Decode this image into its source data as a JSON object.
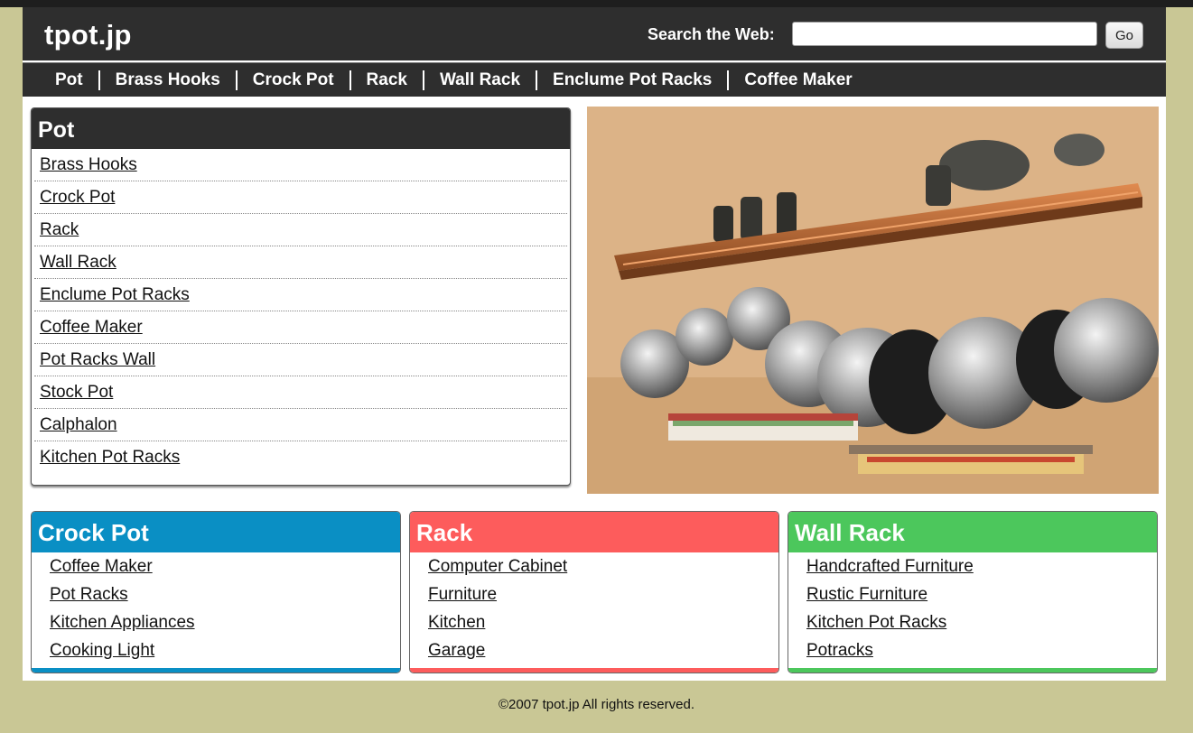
{
  "header": {
    "logo": "tpot.jp",
    "search_label": "Search the Web:",
    "search_placeholder": "",
    "go_label": "Go"
  },
  "nav": [
    "Pot",
    "Brass Hooks",
    "Crock Pot",
    "Rack",
    "Wall Rack",
    "Enclume Pot Racks",
    "Coffee Maker"
  ],
  "pot_panel": {
    "title": "Pot",
    "links": [
      "Brass Hooks",
      "Crock Pot",
      "Rack",
      "Wall Rack",
      "Enclume Pot Racks",
      "Coffee Maker",
      "Pot Racks Wall",
      "Stock Pot",
      "Calphalon",
      "Kitchen Pot Racks"
    ]
  },
  "boxes": [
    {
      "title": "Crock Pot",
      "color": "#0a8fc4",
      "links": [
        "Coffee Maker",
        "Pot Racks",
        "Kitchen Appliances",
        "Cooking Light"
      ]
    },
    {
      "title": "Rack",
      "color": "#fd5c5c",
      "links": [
        "Computer Cabinet",
        "Furniture",
        "Kitchen",
        "Garage"
      ]
    },
    {
      "title": "Wall Rack",
      "color": "#4cc75c",
      "links": [
        "Handcrafted Furniture",
        "Rustic Furniture",
        "Kitchen Pot Racks",
        "Potracks"
      ]
    }
  ],
  "footer": "©2007 tpot.jp All rights reserved.",
  "colors": {
    "page_bg": "#c9c795",
    "header_bg": "#2e2e2e"
  }
}
